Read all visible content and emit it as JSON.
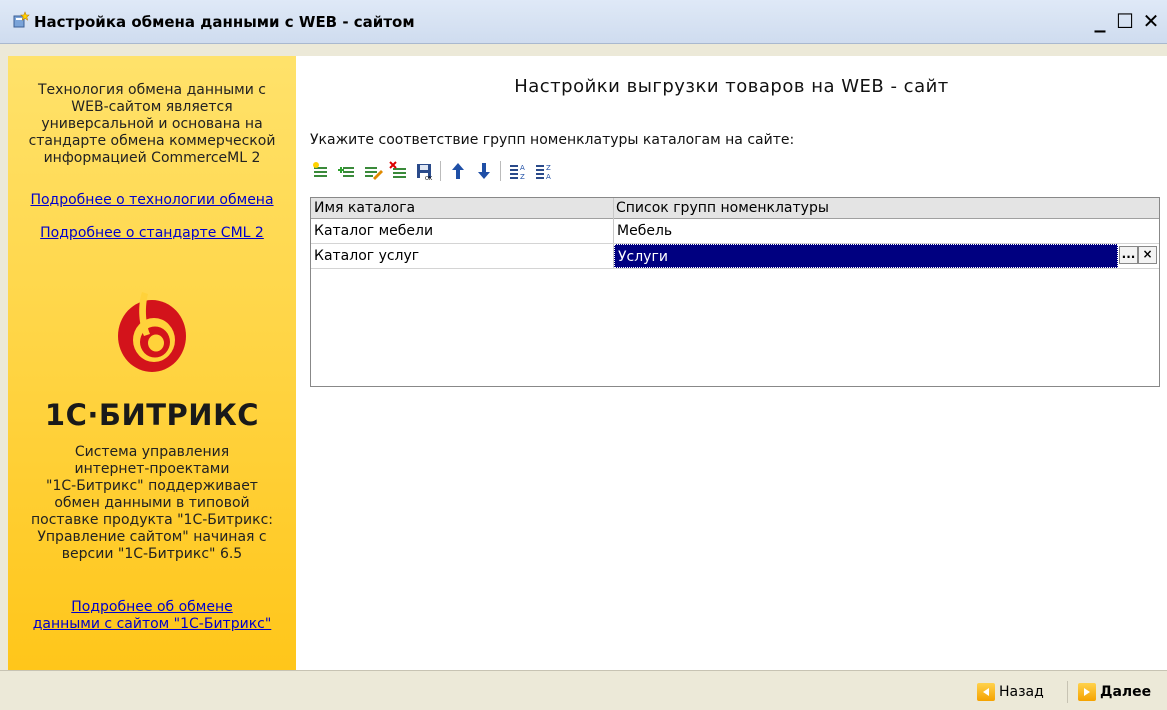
{
  "window": {
    "title": "Настройка обмена данными с WEB - сайтом",
    "controls": {
      "minimize": "_",
      "maximize": "☐",
      "close": "✕"
    }
  },
  "sidebar": {
    "intro_text": "Технология обмена данными с\nWEB-сайтом является\nуниверсальной и основана на\nстандарте обмена коммерческой\nинформацией CommerceML 2",
    "link_technology": "Подробнее о технологии обмена",
    "link_standard": "Подробнее о стандарте CML 2",
    "logo_text": "1С·БИТРИКС",
    "bitrix_text": "Система управления\nинтернет-проектами\n\"1С-Битрикс\" поддерживает\nобмен данными в типовой\nпоставке продукта \"1С-Битрикс:\nУправление сайтом\" начиная с\nверсии \"1С-Битрикс\" 6.5",
    "link_bitrix": "Подробнее об обмене\nданными с сайтом \"1С-Битрикс\"",
    "colors": {
      "background_top": "#ffe26b",
      "background_bottom": "#ffc61a",
      "logo_red": "#d3131b"
    }
  },
  "main": {
    "title": "Настройки выгрузки товаров на WEB - сайт",
    "instruction": "Укажите соответствие групп номенклатуры каталогам на сайте:",
    "toolbar": {
      "icons": [
        "add-row-icon",
        "add-child-row-icon",
        "edit-row-icon",
        "delete-row-icon",
        "save-ok-icon",
        "move-up-icon",
        "move-down-icon",
        "sort-ascending-icon",
        "sort-descending-icon"
      ]
    },
    "table": {
      "columns": [
        "Имя каталога",
        "Список групп номенклатуры"
      ],
      "rows": [
        [
          "Каталог мебели",
          "Мебель"
        ],
        [
          "Каталог услуг",
          "Услуги"
        ]
      ],
      "selected_row": 1,
      "edit_buttons": {
        "select": "...",
        "clear": "×"
      }
    }
  },
  "navigation": {
    "back_label": "Назад",
    "next_label": "Далее"
  },
  "colors": {
    "selection": "#000080",
    "link": "#0000cc",
    "accent_orange": "#f5a200"
  }
}
